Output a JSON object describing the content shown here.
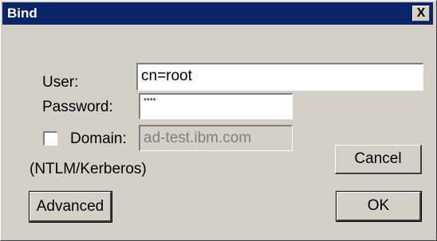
{
  "window": {
    "title": "Bind",
    "close_label": "X"
  },
  "form": {
    "user_label": "User:",
    "user_value": "cn=root",
    "password_label": "Password:",
    "password_value": "****",
    "domain_label": "Domain:",
    "domain_value": "ad-test.ibm.com",
    "domain_checked": false,
    "domain_note": "(NTLM/Kerberos)"
  },
  "buttons": {
    "cancel": "Cancel",
    "advanced": "Advanced",
    "ok": "OK"
  }
}
